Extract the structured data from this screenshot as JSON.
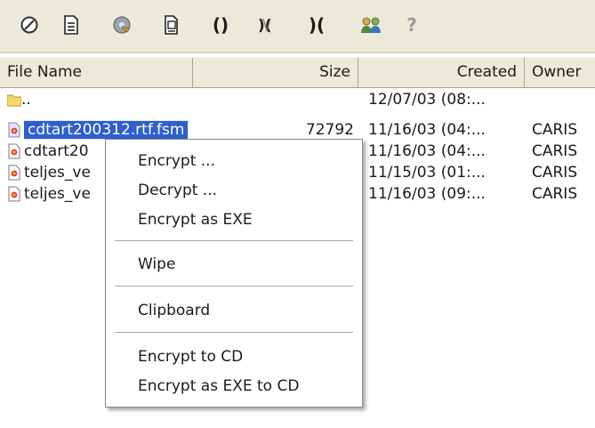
{
  "toolbar": {
    "buttons": [
      {
        "name": "wipe-icon"
      },
      {
        "name": "document-icon"
      },
      {
        "name": "disk-key-icon"
      },
      {
        "name": "copy-document-icon"
      },
      {
        "name": "parentheses-open-icon",
        "glyph": "()"
      },
      {
        "name": "split-encrypt-icon",
        "glyph": "%"
      },
      {
        "name": "parentheses-close-icon",
        "glyph": ")("
      },
      {
        "name": "users-icon"
      },
      {
        "name": "help-icon",
        "glyph": "?"
      }
    ]
  },
  "columns": {
    "file_name": "File Name",
    "size": "Size",
    "created": "Created",
    "owner": "Owner"
  },
  "rows": [
    {
      "name": "..",
      "size": "",
      "created": "12/07/03 (08:...",
      "owner": "",
      "icon": "folder-icon"
    },
    {
      "name": "cdtart200312.rtf.fsm",
      "size": "72792",
      "created": "11/16/03 (04:...",
      "owner": "CARIS",
      "icon": "encrypted-file-icon",
      "selected": true
    },
    {
      "name": "cdtart20",
      "size": "",
      "created": "11/16/03 (04:...",
      "owner": "CARIS",
      "icon": "rtf-file-icon"
    },
    {
      "name": "teljes_ve",
      "size": "",
      "created": "11/15/03 (01:...",
      "owner": "CARIS",
      "icon": "rtf-file-icon"
    },
    {
      "name": "teljes_ve",
      "size": "",
      "created": "11/16/03 (09:...",
      "owner": "CARIS",
      "icon": "rtf-file-icon"
    }
  ],
  "context_menu": {
    "encrypt": "Encrypt ...",
    "decrypt": "Decrypt ...",
    "encrypt_exe": "Encrypt as EXE",
    "wipe": "Wipe",
    "clipboard": "Clipboard",
    "encrypt_cd": "Encrypt to CD",
    "encrypt_exe_cd": "Encrypt as EXE to CD"
  }
}
